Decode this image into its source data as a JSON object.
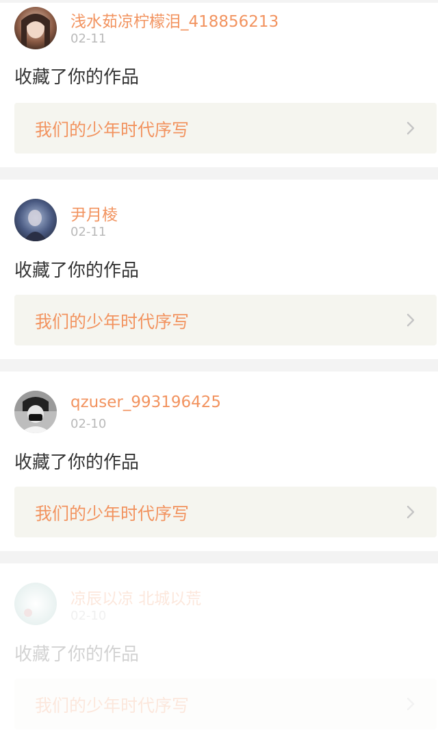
{
  "notifications": [
    {
      "username": "浅水茹凉柠檬泪_418856213",
      "date": "02-11",
      "action": "收藏了你的作品",
      "work_title": "我们的少年时代序写",
      "avatar_icon": "user-avatar-icon",
      "avatar_colors": [
        "#3b2a22",
        "#c89a7f"
      ]
    },
    {
      "username": "尹月棱",
      "date": "02-11",
      "action": "收藏了你的作品",
      "work_title": "我们的少年时代序写",
      "avatar_icon": "user-avatar-icon",
      "avatar_colors": [
        "#2c3a5c",
        "#9db0cf"
      ]
    },
    {
      "username": "qzuser_993196425",
      "date": "02-10",
      "action": "收藏了你的作品",
      "work_title": "我们的少年时代序写",
      "avatar_icon": "user-avatar-icon",
      "avatar_colors": [
        "#3a3a3a",
        "#bdbdbd"
      ]
    },
    {
      "username": "凉辰以凉    北城以荒",
      "date": "02-10",
      "action": "收藏了你的作品",
      "work_title": "我们的少年时代序写",
      "avatar_icon": "user-avatar-icon",
      "avatar_colors": [
        "#8fb9b4",
        "#e6f0ee"
      ]
    }
  ],
  "colors": {
    "accent": "#f2935f",
    "date": "#b9b9b9",
    "text": "#333333",
    "link_bg": "#f5f5ef",
    "page_bg": "#f3f3f3"
  }
}
